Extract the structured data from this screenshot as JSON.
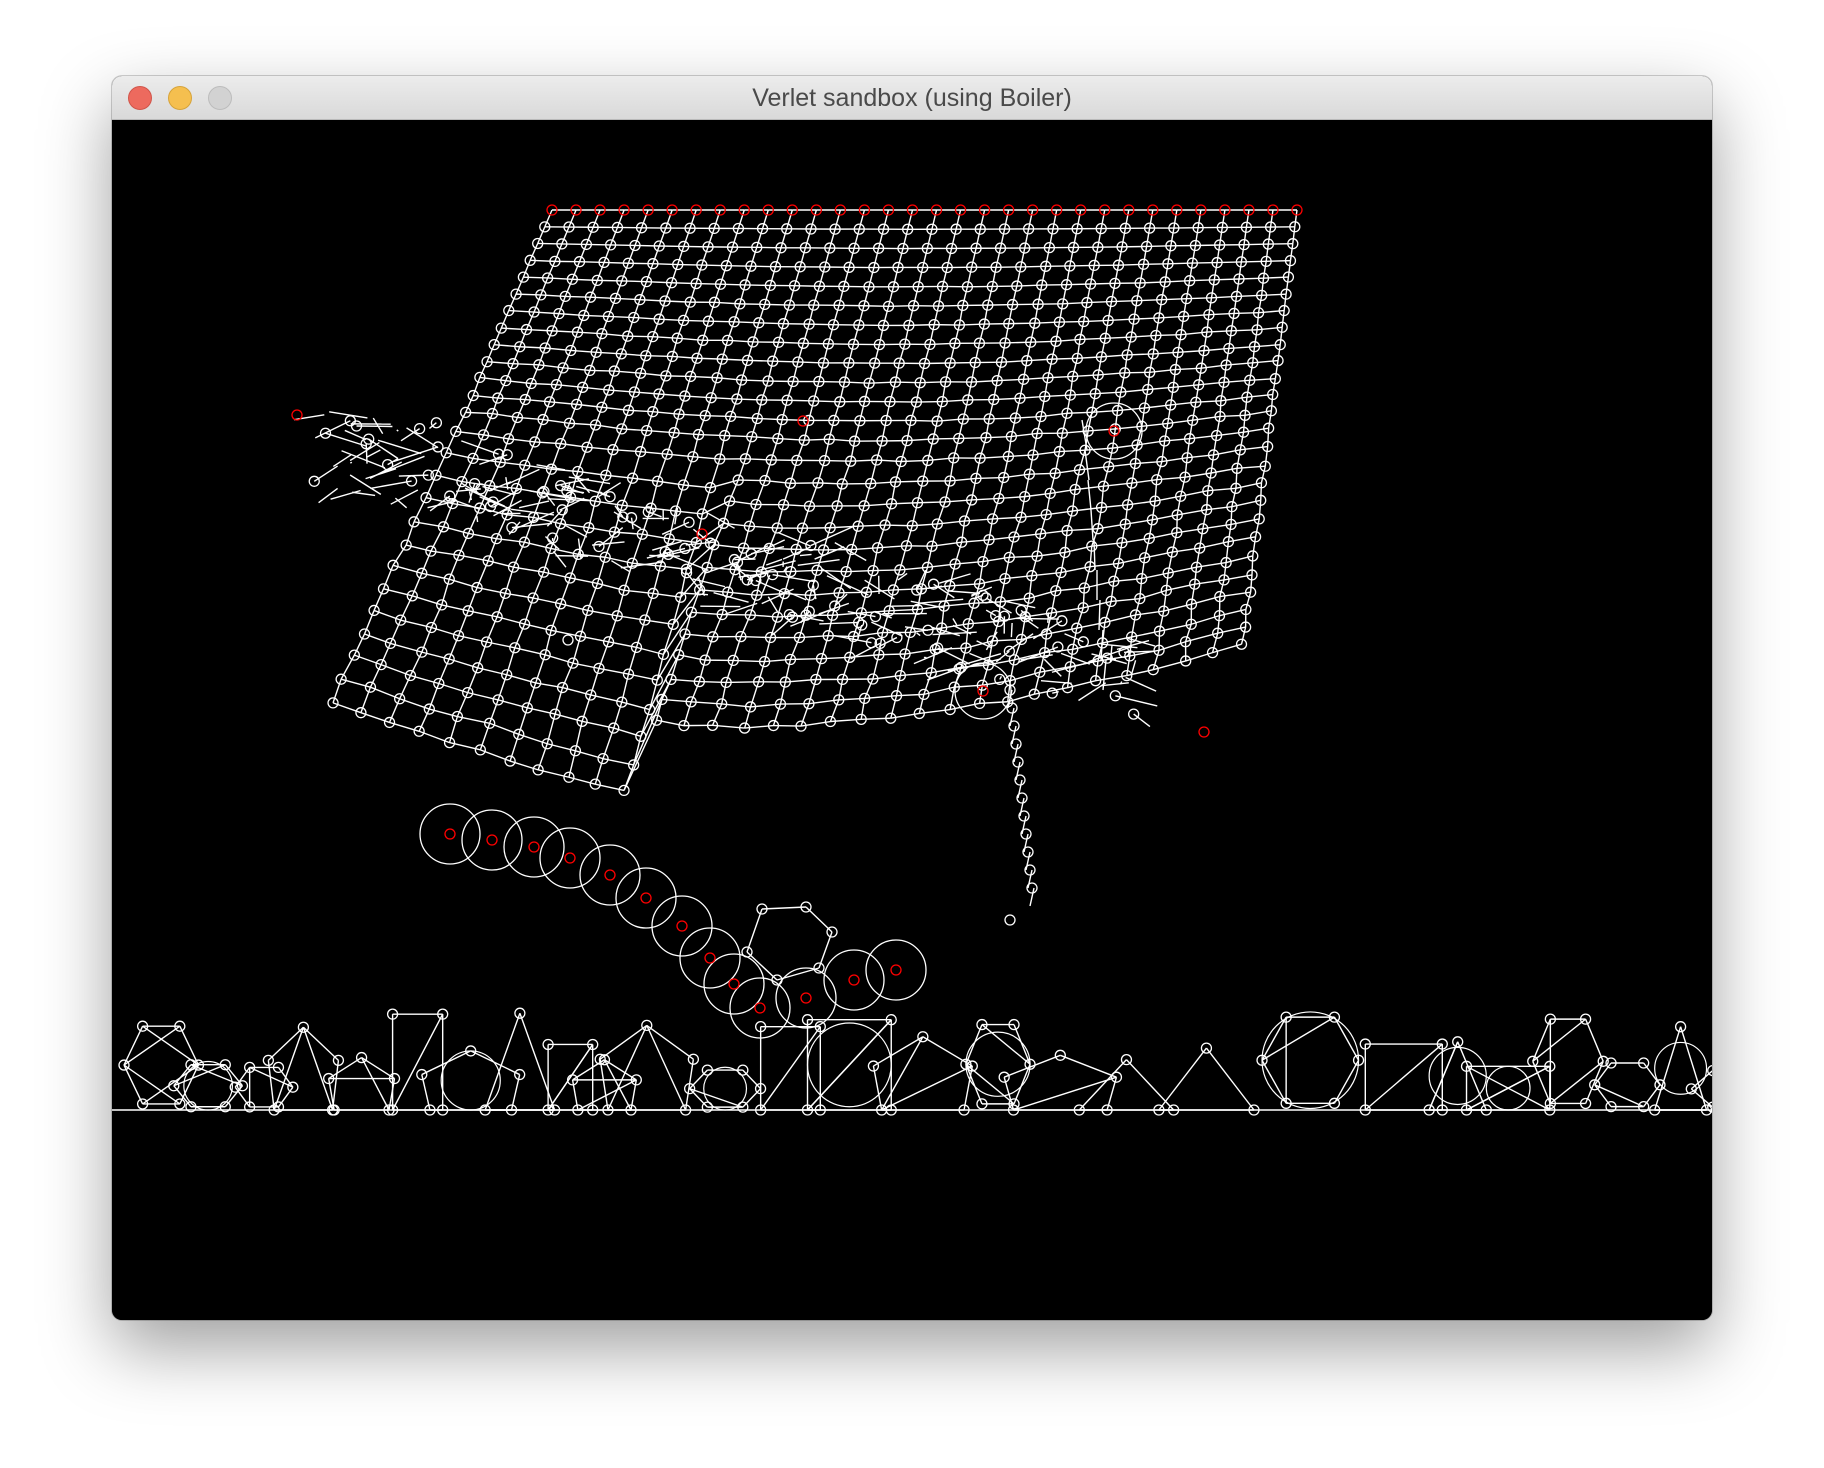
{
  "window": {
    "title": "Verlet sandbox (using Boiler)",
    "controls": [
      "close-icon",
      "minimize-icon",
      "zoom-icon"
    ]
  },
  "canvas": {
    "background": "#000000",
    "constraint_color": "#ffffff",
    "point_color": "#ffffff",
    "pinned_point_color": "#ff0000"
  }
}
